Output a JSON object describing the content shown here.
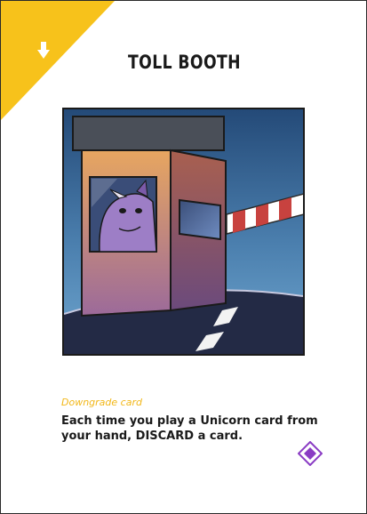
{
  "card": {
    "title": "TOLL BOOTH",
    "card_type": "Downgrade card",
    "effect_text": "Each time you play a Unicorn card from your hand, DISCARD a card."
  },
  "corner_icon": "down-arrow-icon",
  "symbol_icon": "purple-diamond-icon",
  "colors": {
    "corner_accent": "#f7c21b",
    "card_type_text": "#f2b718",
    "symbol": "#8a3cc4",
    "border": "#2a2a2a"
  }
}
